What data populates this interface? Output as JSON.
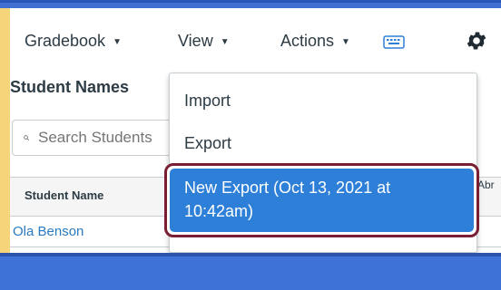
{
  "toolbar": {
    "gradebook_label": "Gradebook",
    "view_label": "View",
    "actions_label": "Actions"
  },
  "sidebar": {
    "student_names_label": "Student Names"
  },
  "search": {
    "placeholder": "Search Students"
  },
  "table": {
    "columns": [
      "Student Name",
      "Abr"
    ],
    "rows": [
      {
        "student": "Ola Benson"
      }
    ]
  },
  "actions_menu": {
    "items": [
      "Import",
      "Export",
      "New Export (Oct 13, 2021 at 10:42am)"
    ],
    "highlighted_index": 2
  },
  "icons": {
    "toolbar": [
      "keyboard-icon",
      "gear-icon"
    ],
    "search": "search-icon",
    "caret": "caret-down-icon"
  },
  "colors": {
    "accent_blue": "#2d7fd8",
    "highlight_border": "#7a1e33",
    "link": "#2a7abf",
    "frame_blue": "#3f72d6",
    "frame_yellow": "#f6d57a"
  }
}
